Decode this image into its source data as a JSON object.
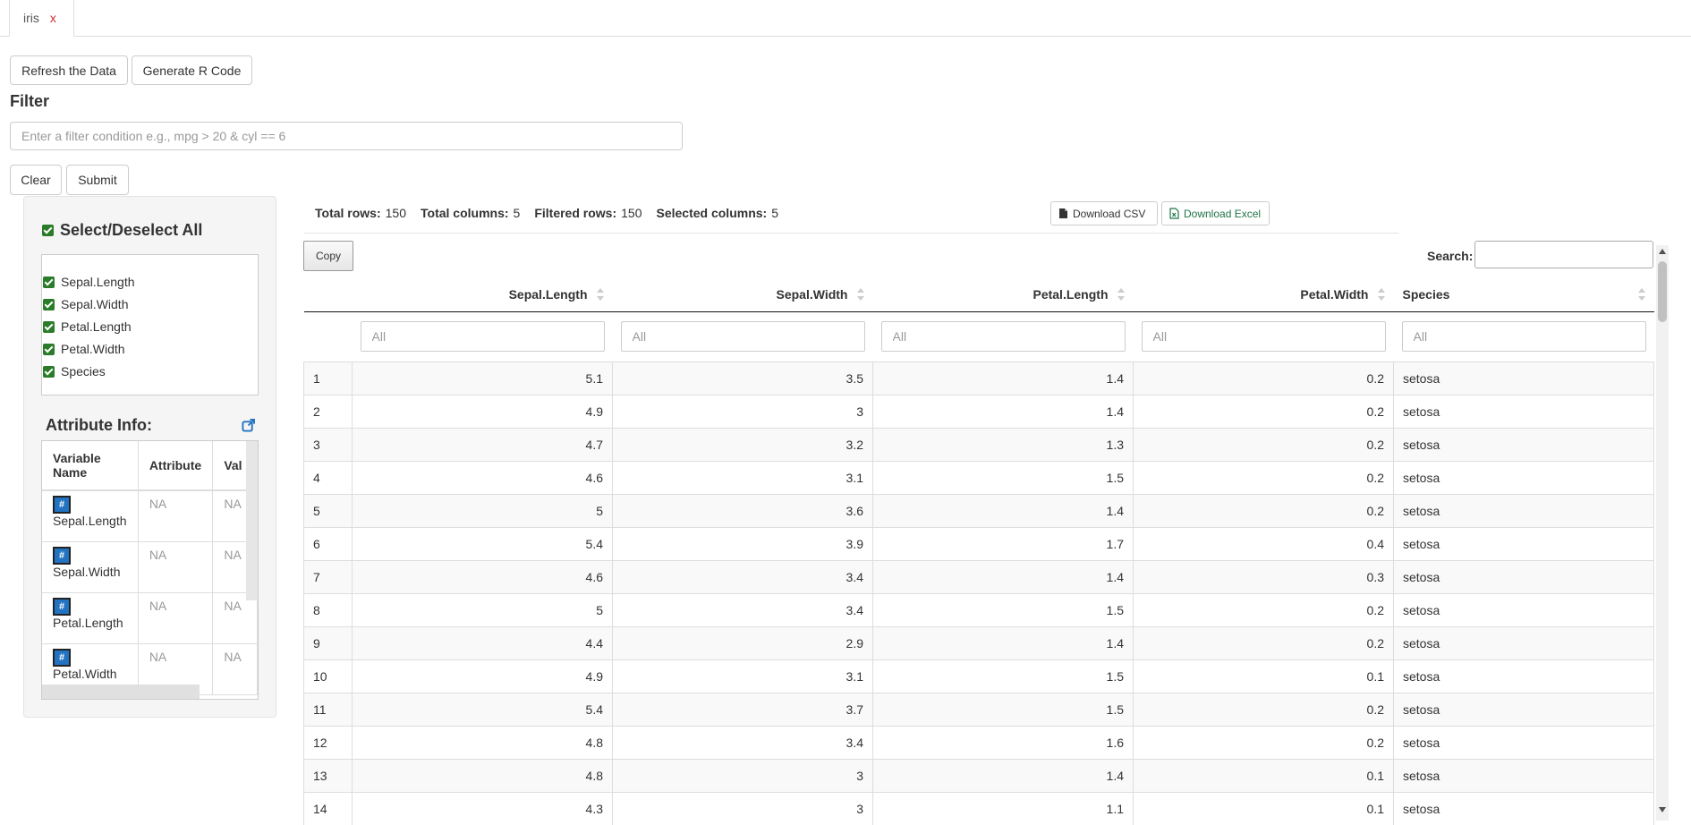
{
  "tabs": [
    {
      "label": "iris",
      "close": "x"
    }
  ],
  "toolbar": {
    "refresh_label": "Refresh the Data",
    "generate_label": "Generate R Code"
  },
  "filter": {
    "title": "Filter",
    "placeholder": "Enter a filter condition e.g., mpg > 20 & cyl == 6",
    "clear_label": "Clear",
    "submit_label": "Submit"
  },
  "sidebar": {
    "select_all_label": "Select/Deselect All",
    "columns": [
      "Sepal.Length",
      "Sepal.Width",
      "Petal.Length",
      "Petal.Width",
      "Species"
    ],
    "attr_title": "Attribute Info:",
    "attr_table": {
      "headers": [
        "Variable Name",
        "Attribute",
        "Val"
      ],
      "rows": [
        {
          "type_icon": "#",
          "name": "Sepal.Length",
          "attribute": "NA",
          "value": "NA"
        },
        {
          "type_icon": "#",
          "name": "Sepal.Width",
          "attribute": "NA",
          "value": "NA"
        },
        {
          "type_icon": "#",
          "name": "Petal.Length",
          "attribute": "NA",
          "value": "NA"
        },
        {
          "type_icon": "#",
          "name": "Petal.Width",
          "attribute": "NA",
          "value": "NA"
        }
      ]
    }
  },
  "stats": {
    "total_rows_label": "Total rows:",
    "total_rows": "150",
    "total_cols_label": "Total columns:",
    "total_cols": "5",
    "filtered_label": "Filtered rows:",
    "filtered": "150",
    "selected_label": "Selected columns:",
    "selected": "5"
  },
  "downloads": {
    "csv_label": "Download CSV",
    "excel_label": "Download Excel"
  },
  "table": {
    "copy_label": "Copy",
    "search_label": "Search:",
    "filter_placeholder": "All",
    "columns": [
      "Sepal.Length",
      "Sepal.Width",
      "Petal.Length",
      "Petal.Width",
      "Species"
    ],
    "rows": [
      [
        "1",
        "5.1",
        "3.5",
        "1.4",
        "0.2",
        "setosa"
      ],
      [
        "2",
        "4.9",
        "3",
        "1.4",
        "0.2",
        "setosa"
      ],
      [
        "3",
        "4.7",
        "3.2",
        "1.3",
        "0.2",
        "setosa"
      ],
      [
        "4",
        "4.6",
        "3.1",
        "1.5",
        "0.2",
        "setosa"
      ],
      [
        "5",
        "5",
        "3.6",
        "1.4",
        "0.2",
        "setosa"
      ],
      [
        "6",
        "5.4",
        "3.9",
        "1.7",
        "0.4",
        "setosa"
      ],
      [
        "7",
        "4.6",
        "3.4",
        "1.4",
        "0.3",
        "setosa"
      ],
      [
        "8",
        "5",
        "3.4",
        "1.5",
        "0.2",
        "setosa"
      ],
      [
        "9",
        "4.4",
        "2.9",
        "1.4",
        "0.2",
        "setosa"
      ],
      [
        "10",
        "4.9",
        "3.1",
        "1.5",
        "0.1",
        "setosa"
      ],
      [
        "11",
        "5.4",
        "3.7",
        "1.5",
        "0.2",
        "setosa"
      ],
      [
        "12",
        "4.8",
        "3.4",
        "1.6",
        "0.2",
        "setosa"
      ],
      [
        "13",
        "4.8",
        "3",
        "1.4",
        "0.1",
        "setosa"
      ],
      [
        "14",
        "4.3",
        "3",
        "1.1",
        "0.1",
        "setosa"
      ]
    ]
  },
  "colors": {
    "accent": "#2274c2",
    "check": "#2a7b2a",
    "close": "#c9302c",
    "excel": "#217346"
  }
}
